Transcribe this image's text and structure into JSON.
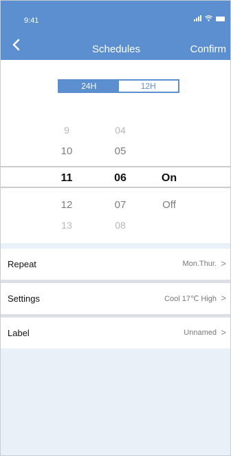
{
  "status_bar": {
    "time": "9:41"
  },
  "header": {
    "title": "Schedules",
    "confirm_label": "Confirm"
  },
  "format_toggle": {
    "options": [
      "24H",
      "12H"
    ],
    "selected": "12H"
  },
  "picker": {
    "hours": [
      "9",
      "10",
      "11",
      "12",
      "13"
    ],
    "minutes": [
      "04",
      "05",
      "06",
      "07",
      "08"
    ],
    "states": [
      "On",
      "Off"
    ],
    "selected": {
      "hour": "11",
      "minute": "06",
      "state": "On"
    }
  },
  "settings": [
    {
      "label": "Repeat",
      "value": "Mon.Thur."
    },
    {
      "label": "Settings",
      "value": "Cool 17℃ High"
    },
    {
      "label": "Label",
      "value": "Unnamed"
    }
  ],
  "chevron": ">",
  "colors": {
    "accent": "#5c8fd0",
    "background": "#e9f0f8"
  }
}
